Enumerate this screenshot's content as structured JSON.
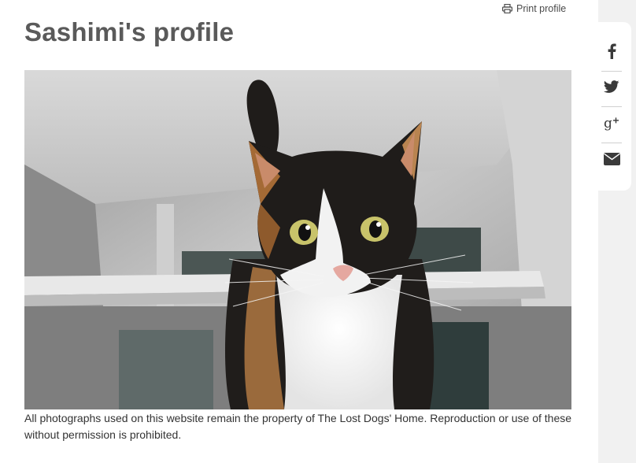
{
  "header": {
    "print_label": "Print profile",
    "print_icon": "printer-icon",
    "title": "Sashimi's profile"
  },
  "photo": {
    "subject": "calico-cat-photo"
  },
  "caption": "All photographs used on this website remain the property of The Lost Dogs' Home. Reproduction or use of these without permission is prohibited.",
  "share": {
    "items": [
      {
        "icon": "facebook-icon"
      },
      {
        "icon": "twitter-icon"
      },
      {
        "icon": "google-plus-icon"
      },
      {
        "icon": "email-icon"
      }
    ]
  },
  "colors": {
    "title": "#5a5a5a",
    "text": "#333333",
    "share_icon": "#3a3a3a",
    "sidebar_bg": "#f1f1f1"
  }
}
